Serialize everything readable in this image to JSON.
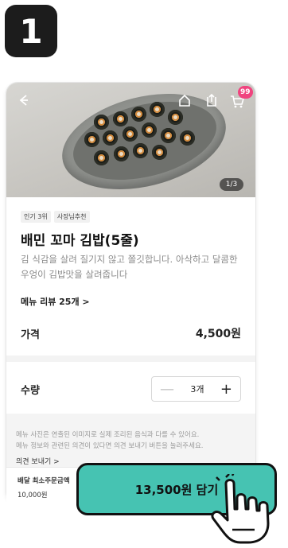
{
  "step": {
    "number": "1"
  },
  "header": {
    "back_icon": "back-arrow-icon",
    "home_icon": "home-icon",
    "share_icon": "share-icon",
    "cart_icon": "cart-icon",
    "cart_count": "99",
    "image_pager": "1/3"
  },
  "product": {
    "badges": [
      "인기 3위",
      "사장님추천"
    ],
    "name": "배민 꼬마 김밥(5줄)",
    "description": "김 식감을 살려 질기지 않고 쫄깃합니다. 아삭하고 달콤한 우엉이 김밥맛을 살려줍니다",
    "review_link": "메뉴 리뷰 25개 >"
  },
  "price": {
    "label": "가격",
    "value": "4,500원"
  },
  "quantity": {
    "label": "수량",
    "value": "3개",
    "minus": "—",
    "plus": "+"
  },
  "notice": {
    "line1": "메뉴 사진은 연출된 이미지로 실제 조리된 음식과 다를 수 있어요.",
    "line2": "메뉴 정보와 관련된 의견이 있다면 의견 보내기 버튼을 눌러주세요.",
    "feedback_link": "의견 보내기 >"
  },
  "footer": {
    "min_order_label": "배달 최소주문금액",
    "min_order_value": "10,000원",
    "add_button": "13,500원 담기"
  },
  "colors": {
    "accent": "#46c3b2",
    "cart_badge": "#f0447f",
    "step_badge": "#1c1c1c"
  }
}
